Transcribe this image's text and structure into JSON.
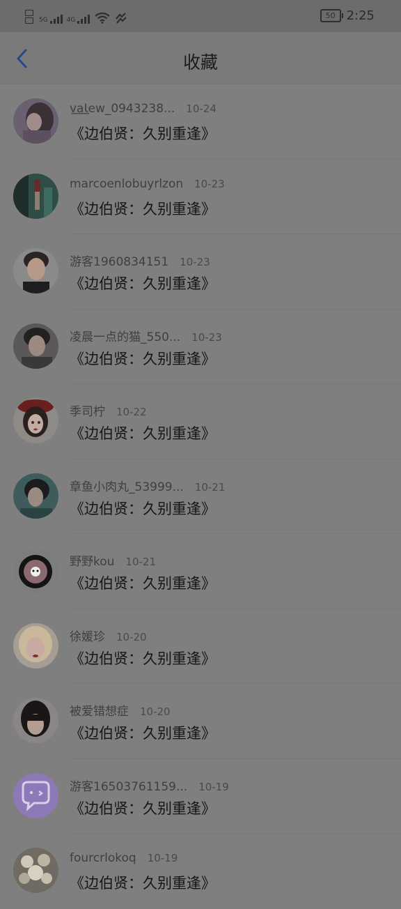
{
  "status_bar": {
    "signal1_label": "5G",
    "signal2_label": "4G",
    "battery": "50",
    "time": "2:25"
  },
  "header": {
    "title": "收藏"
  },
  "items": [
    {
      "user": "v͟a͟Ɩew_0943238...",
      "date": "10-24",
      "work": "《边伯贤：久别重逢》",
      "avatar": "photo-girl-dark"
    },
    {
      "user": "marcoenlobuyrlzon",
      "date": "10-23",
      "work": "《边伯贤：久别重逢》",
      "avatar": "photo-lipstick-green"
    },
    {
      "user": "游客1960834151",
      "date": "10-23",
      "work": "《边伯贤：久别重逢》",
      "avatar": "photo-boy"
    },
    {
      "user": "凌晨一点的猫_550...",
      "date": "10-23",
      "work": "《边伯贤：久别重逢》",
      "avatar": "photo-man"
    },
    {
      "user": "季司柠",
      "date": "10-22",
      "work": "《边伯贤：久别重逢》",
      "avatar": "illustration-girl-hat"
    },
    {
      "user": "章鱼小肉丸_53999...",
      "date": "10-21",
      "work": "《边伯贤：久别重逢》",
      "avatar": "photo-girl-teal"
    },
    {
      "user": "野野kou",
      "date": "10-21",
      "work": "《边伯贤：久别重逢》",
      "avatar": "cartoon-donut"
    },
    {
      "user": "徐媛珍",
      "date": "10-20",
      "work": "《边伯贤：久别重逢》",
      "avatar": "photo-blonde-girl"
    },
    {
      "user": "被爱错想症",
      "date": "10-20",
      "work": "《边伯贤：久别重逢》",
      "avatar": "photo-girl-bangs"
    },
    {
      "user": "游客16503761159...",
      "date": "10-19",
      "work": "《边伯贤：久别重逢》",
      "avatar": "default-chat-icon"
    },
    {
      "user": "fourcrlokoq",
      "date": "10-19",
      "work": "《边伯贤：久别重逢》",
      "avatar": "photo-pearls"
    }
  ],
  "colors": {
    "overlay": "#7f7f7f",
    "accent_back": "#1f4a8a",
    "default_avatar": "#8e79b8"
  }
}
